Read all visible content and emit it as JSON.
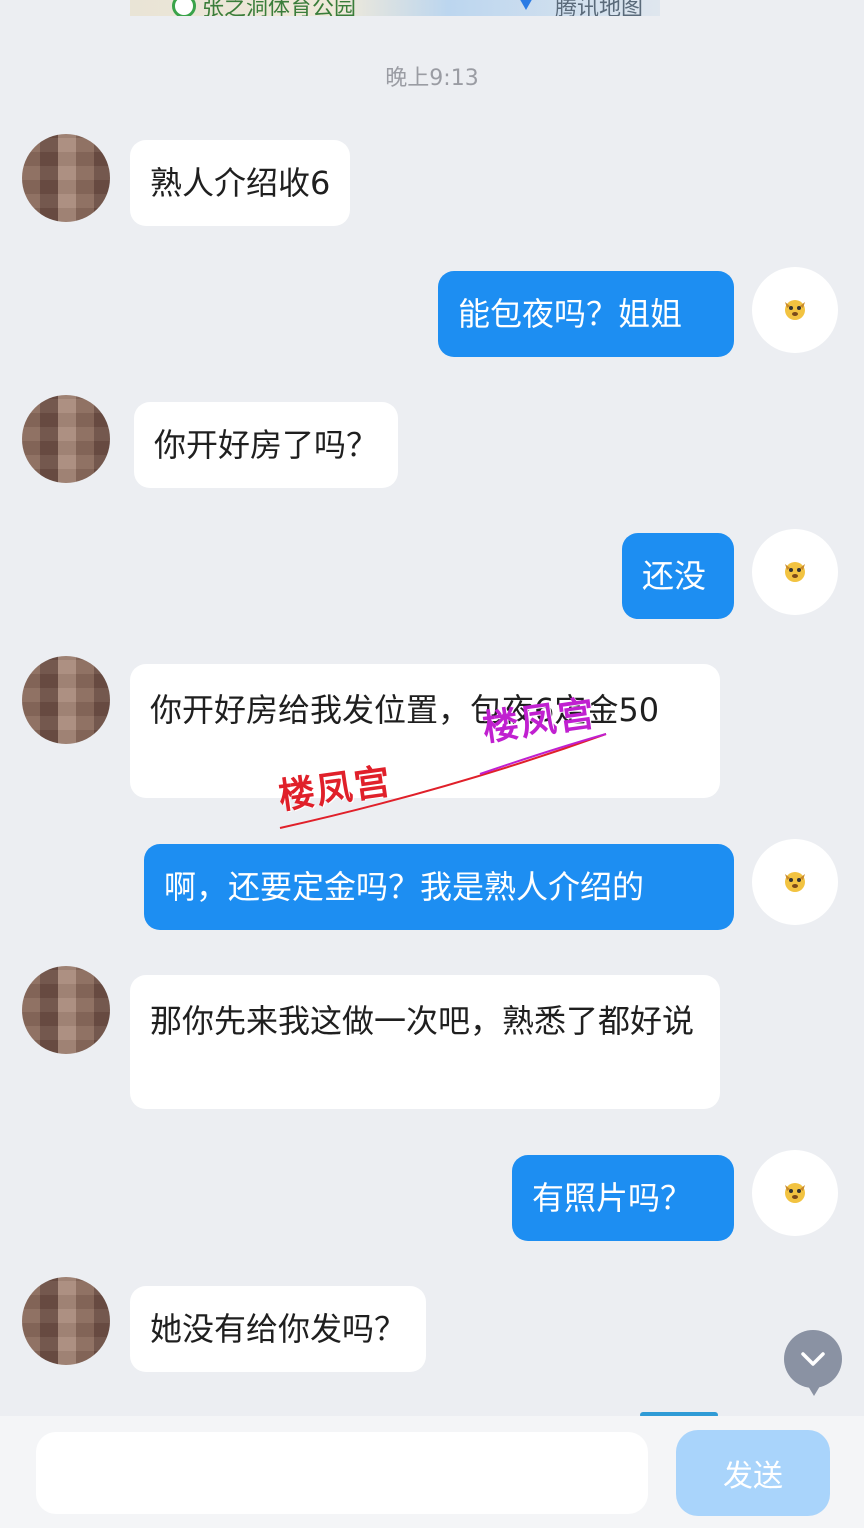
{
  "map_preview": {
    "place_label": "张之洞体育公园",
    "provider_label": "腾讯地图"
  },
  "timestamp": "晚上9:13",
  "messages": [
    {
      "side": "in",
      "text": "熟人介绍收6"
    },
    {
      "side": "out",
      "text": "能包夜吗？姐姐"
    },
    {
      "side": "in",
      "text": "你开好房了吗？"
    },
    {
      "side": "out",
      "text": "还没"
    },
    {
      "side": "in",
      "text": "你开好房给我发位置，包夜6定金50"
    },
    {
      "side": "out",
      "text": "啊，还要定金吗？我是熟人介绍的"
    },
    {
      "side": "in",
      "text": "那你先来我这做一次吧，熟悉了都好说"
    },
    {
      "side": "out",
      "text": "有照片吗？"
    },
    {
      "side": "in",
      "text": "她没有给你发吗？"
    }
  ],
  "watermarks": [
    "楼凤宫",
    "楼凤宫"
  ],
  "watermark_colors": [
    "#e0202a",
    "#c020d0"
  ],
  "composer": {
    "input_value": "",
    "send_label": "发送"
  },
  "colors": {
    "outgoing_bubble": "#1d8ef2",
    "incoming_bubble": "#ffffff",
    "background": "#eceef2",
    "send_button": "#a9d4fb"
  },
  "icons": {
    "scroll_down": "chevron-down-icon",
    "self_avatar": "dog-sticker-icon",
    "contact_avatar": "pixelated-avatar"
  }
}
